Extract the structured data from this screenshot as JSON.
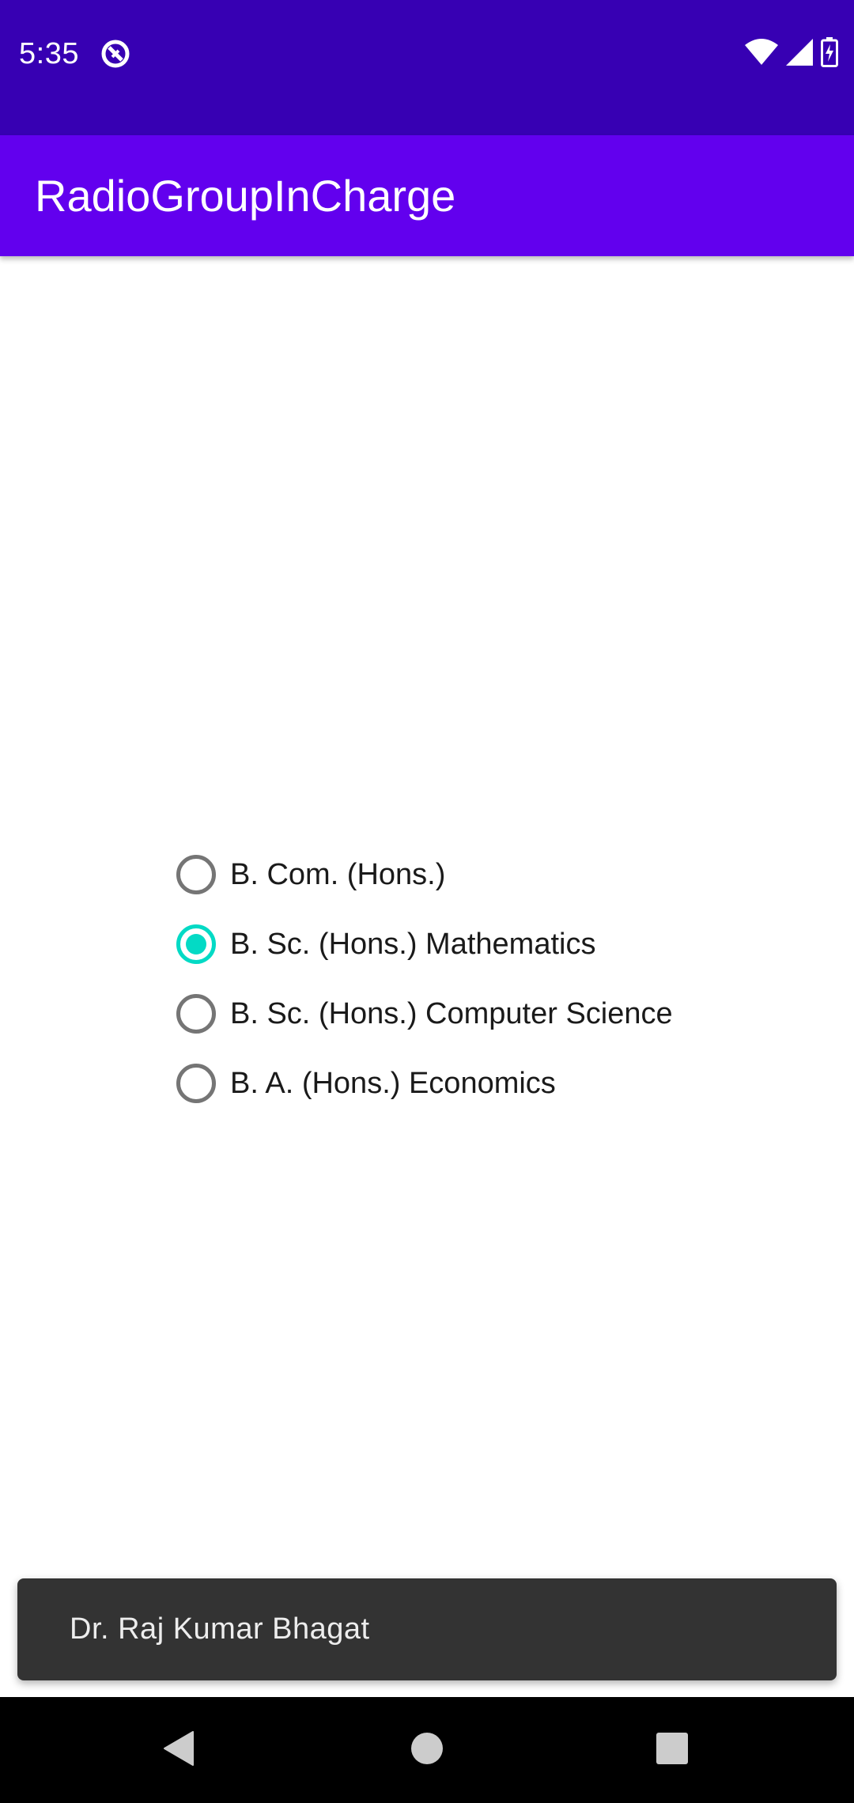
{
  "status_bar": {
    "time": "5:35",
    "icons": [
      "app-notification-icon",
      "wifi-icon",
      "cellular-signal-icon",
      "battery-charging-icon"
    ]
  },
  "app_bar": {
    "title": "RadioGroupInCharge"
  },
  "radio_group": {
    "options": [
      {
        "label": "B. Com. (Hons.)",
        "checked": false
      },
      {
        "label": "B. Sc. (Hons.) Mathematics",
        "checked": true
      },
      {
        "label": "B. Sc. (Hons.) Computer Science",
        "checked": false
      },
      {
        "label": "B. A. (Hons.) Economics",
        "checked": false
      }
    ]
  },
  "snackbar": {
    "text": "Dr. Raj Kumar Bhagat"
  },
  "nav_bar": {
    "buttons": [
      "back-icon",
      "home-icon",
      "recents-icon"
    ]
  },
  "colors": {
    "status_bar": "#3700B3",
    "app_bar": "#6200EE",
    "accent": "#03DAC5",
    "radio_unchecked": "#757575",
    "snackbar_bg": "#333333"
  }
}
